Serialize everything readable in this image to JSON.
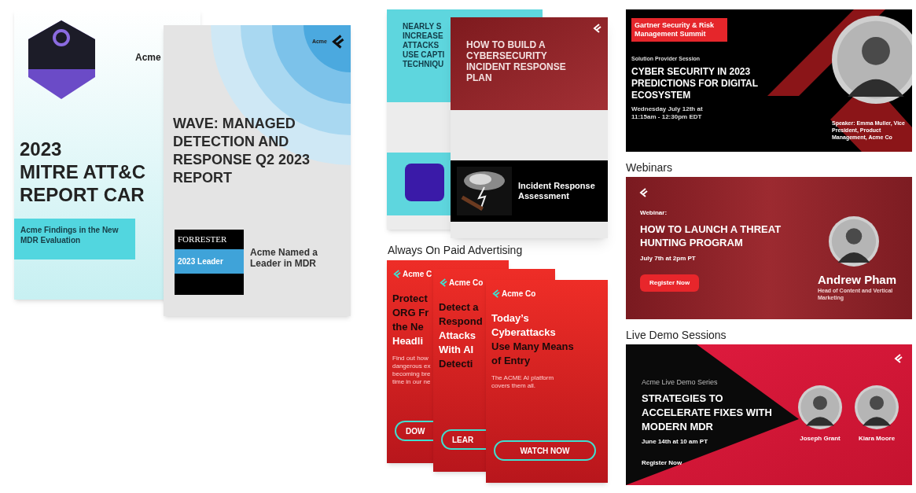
{
  "reports": {
    "mitre": {
      "brand": "Acme",
      "title_lines": [
        "2023",
        "MITRE ATT&C",
        "REPORT CAR"
      ],
      "callout": "Acme Findings in the New MDR Evaluation"
    },
    "wave": {
      "brand": "Acme",
      "title": "WAVE: MANAGED DETECTION AND RESPONSE Q2 2023 REPORT",
      "badge_head": "FORRESTER",
      "badge_label": "2023 Leader",
      "tagline": "Acme Named a Leader in MDR"
    }
  },
  "emails": {
    "captcha": {
      "title_lines": [
        "NEARLY S",
        "INCREASE",
        "ATTACKS",
        "USE CAPTI",
        "TECHNIQU"
      ]
    },
    "incident": {
      "title": "HOW TO BUILD A CYBERSECURITY INCIDENT RESPONSE PLAN",
      "panel_title": "Incident Response Assessment"
    }
  },
  "ads_caption": "Always On Paid Advertising",
  "ads": [
    {
      "brand": "Acme C",
      "headline": [
        {
          "text": "Protect",
          "dark": true
        },
        {
          "text": "ORG Fr",
          "dark": true
        },
        {
          "text": "the Ne",
          "dark": true
        },
        {
          "text": "Headli",
          "dark": false
        }
      ],
      "body_lines": [
        "Find out how",
        "dangerous ex",
        "becoming bre",
        "time in our ne"
      ],
      "button": "DOW"
    },
    {
      "brand": "Acme Co",
      "headline": [
        {
          "text": "Detect a",
          "dark": true
        },
        {
          "text": "Respond",
          "dark": true
        },
        {
          "text": "Attacks",
          "dark": false
        },
        {
          "text": "With AI",
          "dark": false
        },
        {
          "text": "Detecti",
          "dark": true
        }
      ],
      "button": "LEAR"
    },
    {
      "brand": "Acme Co",
      "headline": [
        {
          "text": "Today’s",
          "dark": false
        },
        {
          "text": "Cyberattacks",
          "dark": false
        },
        {
          "text": "Use Many Means",
          "dark": true
        },
        {
          "text": "of Entry",
          "dark": true
        }
      ],
      "body_lines": [
        "The ACME AI platform",
        "covers them all."
      ],
      "button": "WATCH NOW"
    }
  ],
  "summit": {
    "event": "Gartner Security & Risk Management Summit",
    "session": "Solution Provider Session",
    "title": "CYBER SECURITY IN 2023 PREDICTIONS FOR DIGITAL ECOSYSTEM",
    "date": "Wednesday July 12th at 11:15am - 12:30pm EDT",
    "speaker": "Speaker: Emma Muller, Vice President, Product Management, Acme Co"
  },
  "webinar": {
    "caption": "Webinars",
    "label": "Webinar:",
    "title": "HOW TO LAUNCH A THREAT HUNTING PROGRAM",
    "date": "July 7th at 2pm PT",
    "button": "Register Now",
    "host_name": "Andrew Pham",
    "host_role": "Head of Content and Vertical Marketing"
  },
  "demo": {
    "caption": "Live Demo Sessions",
    "series": "Acme Live Demo Series",
    "title": "STRATEGIES TO ACCELERATE FIXES WITH MODERN MDR",
    "date": "June 14th at 10 am PT",
    "button": "Register Now",
    "speakers": [
      "Joseph Grant",
      "Kiara Moore"
    ]
  }
}
